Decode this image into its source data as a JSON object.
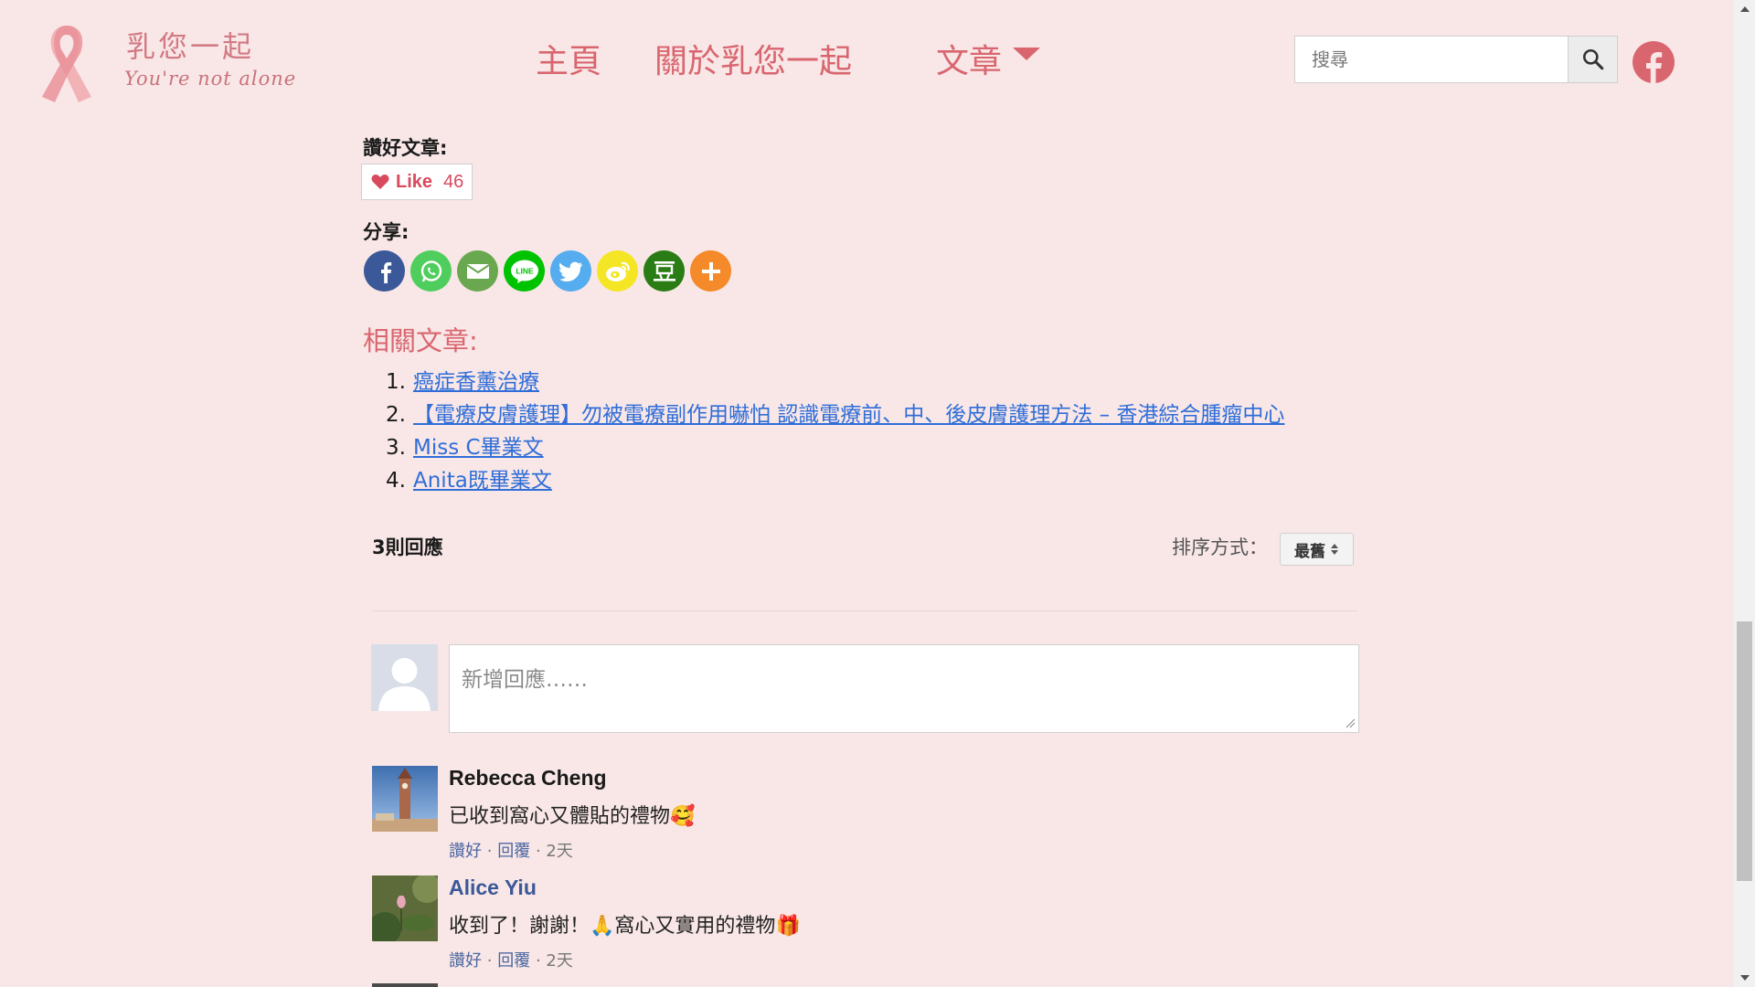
{
  "header": {
    "logo_title": "乳您一起",
    "logo_subtitle": "You're not alone",
    "nav": {
      "home": "主頁",
      "about": "關於乳您一起",
      "articles": "文章"
    },
    "search_placeholder": "搜尋"
  },
  "like_section": {
    "label": "讚好文章:",
    "like_label": "Like",
    "like_count": "46"
  },
  "share_section": {
    "label": "分享:",
    "icons": [
      {
        "name": "facebook-share-icon",
        "color": "#3b5998"
      },
      {
        "name": "whatsapp-share-icon",
        "color": "#4fce5d"
      },
      {
        "name": "email-share-icon",
        "color": "#6aa84f"
      },
      {
        "name": "line-share-icon",
        "color": "#00c300"
      },
      {
        "name": "twitter-share-icon",
        "color": "#55acee"
      },
      {
        "name": "weibo-share-icon",
        "color": "#f5e625"
      },
      {
        "name": "douban-share-icon",
        "color": "#2a7d14"
      },
      {
        "name": "more-share-icon",
        "color": "#f48a2a"
      }
    ]
  },
  "related": {
    "title": "相關文章:",
    "items": [
      {
        "num": "1.",
        "label": "癌症香薰治療"
      },
      {
        "num": "2.",
        "label": "【電療皮膚護理】勿被電療副作用嚇怕 認識電療前、中、後皮膚護理方法 – 香港綜合腫瘤中心"
      },
      {
        "num": "3.",
        "label": "Miss C畢業文"
      },
      {
        "num": "4.",
        "label": "Anita既畢業文"
      }
    ]
  },
  "comments": {
    "count_label": "3則回應",
    "sort_label": "排序方式：",
    "sort_value": "最舊",
    "input_placeholder": "新增回應……",
    "list": [
      {
        "name": "Rebecca Cheng",
        "name_color": "#1a1a1a",
        "text": "已收到窩心又體貼的禮物",
        "emoji": "🥰",
        "like": "讚好",
        "reply": "回覆",
        "time": "2天"
      },
      {
        "name": "Alice Yiu",
        "name_color": "#3b5998",
        "text": "收到了！謝謝！",
        "emoji_mid": "🙏",
        "text2": "窩心又實用的禮物",
        "emoji": "🎁",
        "like": "讚好",
        "reply": "回覆",
        "time": "2天"
      }
    ]
  },
  "colors": {
    "background": "#f9e7e7",
    "accent": "#d9666f",
    "link": "#2f6ed8"
  }
}
